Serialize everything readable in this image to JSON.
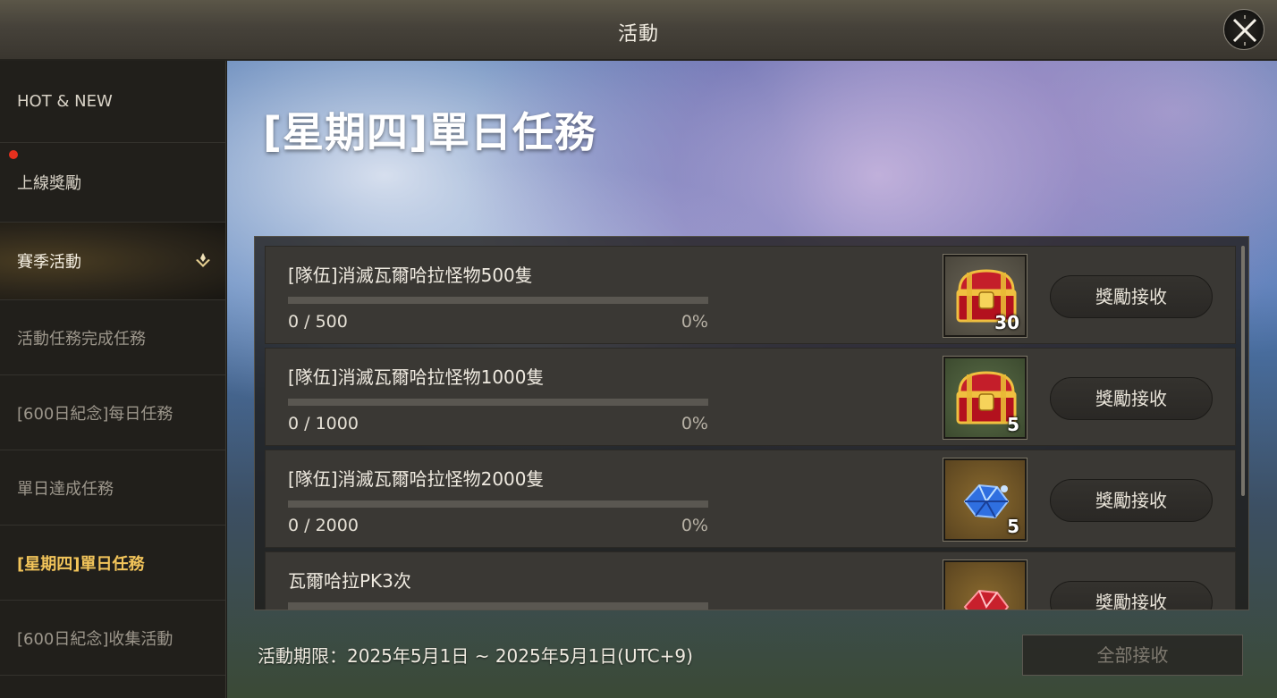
{
  "window": {
    "title": "活動"
  },
  "sidebar": {
    "items": [
      {
        "label": "HOT & NEW"
      },
      {
        "label": "上線獎勵"
      },
      {
        "label": "賽季活動"
      },
      {
        "label": "活動任務完成任務"
      },
      {
        "label": "[600日紀念]每日任務"
      },
      {
        "label": "單日達成任務"
      },
      {
        "label": "[星期四]單日任務"
      },
      {
        "label": "[600日紀念]收集活動"
      }
    ]
  },
  "main": {
    "event_title": "[星期四]單日任務",
    "tasks": [
      {
        "name": "[隊伍]消滅瓦爾哈拉怪物500隻",
        "progress_text": "0 / 500",
        "percent": "0%",
        "progress": 0,
        "reward_icon": "red-treasure-chest-icon",
        "reward_qty": "30",
        "button": "獎勵接收"
      },
      {
        "name": "[隊伍]消滅瓦爾哈拉怪物1000隻",
        "progress_text": "0 / 1000",
        "percent": "0%",
        "progress": 0,
        "reward_icon": "red-treasure-chest-icon",
        "reward_qty": "5",
        "button": "獎勵接收"
      },
      {
        "name": "[隊伍]消滅瓦爾哈拉怪物2000隻",
        "progress_text": "0 / 2000",
        "percent": "0%",
        "progress": 0,
        "reward_icon": "blue-crystal-icon",
        "reward_qty": "5",
        "button": "獎勵接收"
      },
      {
        "name": "瓦爾哈拉PK3次",
        "reward_icon": "red-crystal-icon",
        "button": "獎勵接收"
      }
    ],
    "period": "活動期限：2025年5月1日 ~ 2025年5月1日(UTC+9)",
    "claim_all": "全部接收"
  },
  "colors": {
    "accent_gold": "#f2c45a",
    "notification_red": "#e6301e"
  }
}
